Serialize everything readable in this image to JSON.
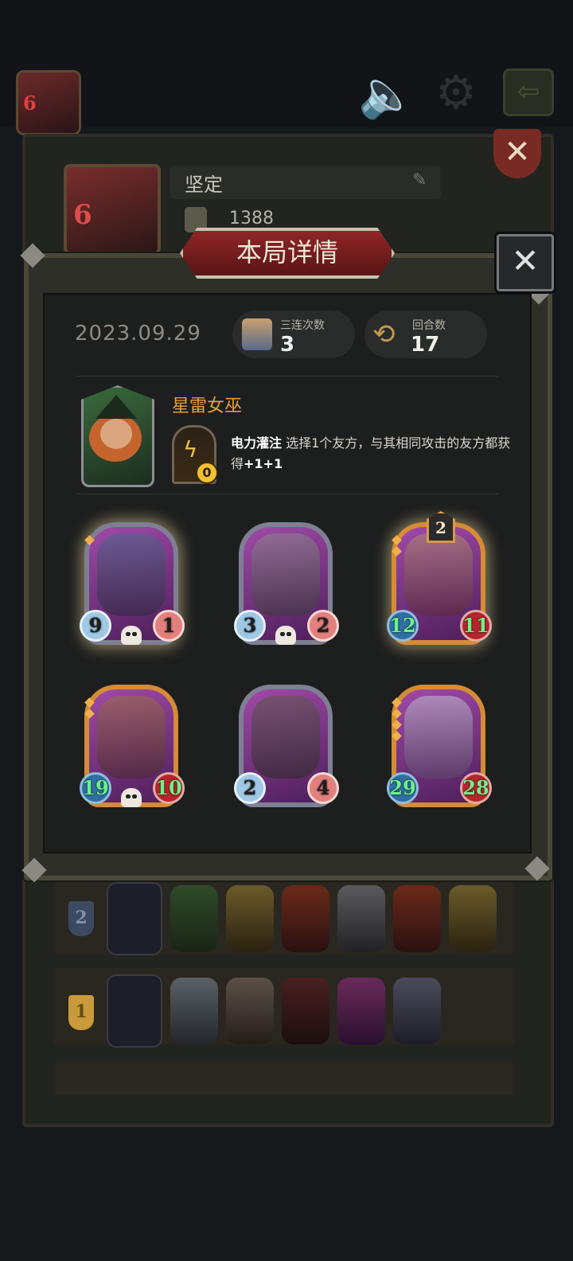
{
  "top_bar": {
    "player_level": "6",
    "icons": [
      "mute-icon",
      "settings-gear-icon",
      "exit-door-icon"
    ]
  },
  "profile": {
    "avatar_level": "6",
    "name": "坚定",
    "score": "1388"
  },
  "dialog": {
    "title": "本局详情",
    "date": "2023.09.29",
    "triples_label": "三连次数",
    "triples_value": "3",
    "rounds_label": "回合数",
    "rounds_value": "17",
    "hero": {
      "name": "星雷女巫",
      "skill_cost": "0",
      "skill_name": "电力灌注",
      "skill_text_a": " 选择1个友方，与其相同攻击的友方都获得",
      "skill_bonus": "+1+1"
    },
    "cards": [
      {
        "attack": "9",
        "health": "1",
        "tier": "",
        "stars": 1,
        "frame": "silver",
        "skull": true
      },
      {
        "attack": "3",
        "health": "2",
        "tier": "",
        "stars": 0,
        "frame": "silver",
        "skull": true
      },
      {
        "attack": "12",
        "health": "11",
        "tier": "2",
        "stars": 2,
        "frame": "gold",
        "skull": false
      },
      {
        "attack": "19",
        "health": "10",
        "tier": "",
        "stars": 2,
        "frame": "gold",
        "skull": true
      },
      {
        "attack": "2",
        "health": "4",
        "tier": "",
        "stars": 0,
        "frame": "silver",
        "skull": false
      },
      {
        "attack": "29",
        "health": "28",
        "tier": "",
        "stars": 4,
        "frame": "gold",
        "skull": false
      }
    ]
  },
  "history": {
    "rows": [
      {
        "rank": "2"
      },
      {
        "rank": "1"
      }
    ]
  },
  "colors": {
    "title_banner": "#8f2628",
    "hero_name": "#e3a23b",
    "buff_stat": "#6ef08a",
    "gold_frame": "#d58c36",
    "silver_frame": "#7e7f93"
  }
}
